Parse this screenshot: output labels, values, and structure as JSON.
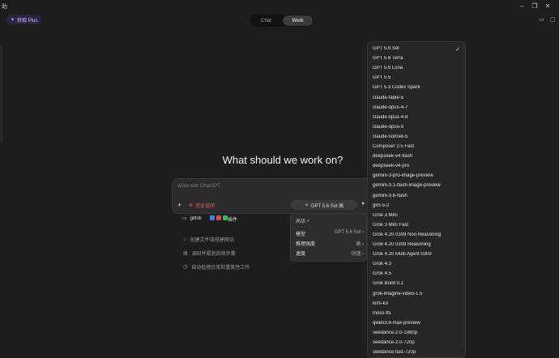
{
  "window": {
    "title_glyph": "助"
  },
  "header": {
    "plus_label": "获取 Plus",
    "tabs": [
      {
        "label": "Chat"
      },
      {
        "label": "Work"
      }
    ]
  },
  "main": {
    "hero_title": "What should we work on?",
    "composer": {
      "placeholder": "Work with ChatGPT",
      "access_label": "完全访问",
      "model_chip": "GPT 5.6 Sol 高"
    },
    "workspace": {
      "name": "gittok",
      "plugins_label": "插件"
    },
    "suggestions": [
      {
        "text": "创建文件或搭建网站"
      },
      {
        "text": "调研并规划后续步骤"
      },
      {
        "text": "自动处理日常和重复性工作"
      }
    ]
  },
  "settings_menu": {
    "title": "高级",
    "rows": [
      {
        "label": "模型",
        "value": "GPT 5.6 Sol"
      },
      {
        "label": "推理强度",
        "value": "高"
      },
      {
        "label": "速度",
        "value": "快速"
      }
    ]
  },
  "model_dropdown": {
    "selected": "GPT 5.6 Sol",
    "items": [
      "GPT 5.6 Sol",
      "GPT 5.6 Terra",
      "GPT 5.6 Luna",
      "GPT 5.5",
      "GPT 5.3 Codex Spark",
      "claude-fable-5",
      "claude-opus-4-7",
      "claude-opus-4-8",
      "claude-opus-5",
      "claude-sonnet-5",
      "Composer 2.5 Fast",
      "deepseek-v4-flash",
      "deepseek-v4-pro",
      "gemini-3-pro-image-preview",
      "gemini-3.1-flash-image-preview",
      "gemini-3.6-flash",
      "glm-5-2",
      "Grok 3 Mini",
      "Grok 3 Mini Fast",
      "Grok 4.20 0309 Non Reasoning",
      "Grok 4.20 0309 Reasoning",
      "Grok 4.20 Multi Agent 0309",
      "Grok 4.3",
      "Grok 4.5",
      "Grok Build 0.1",
      "grok-imagine-video-1.5",
      "kimi-k3",
      "moss-tts",
      "qwen3.8-max-preview",
      "seedance-2.0-1080p",
      "seedance-2.0-720p",
      "seedance-fast-720p"
    ]
  }
}
